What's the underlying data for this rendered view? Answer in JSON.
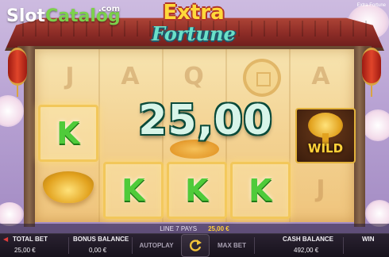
{
  "watermark": {
    "brand_slot": "Slot",
    "brand_catalog": "Catalog",
    "brand_tld": ".com"
  },
  "game_name": "Extra Fortune",
  "logo": {
    "line1": "Extra",
    "line2": "Fortune"
  },
  "reels": {
    "background_symbols": [
      "J",
      "A",
      "Q",
      "A",
      "A",
      "J"
    ],
    "k_symbol": "K",
    "wild_label": "WILD"
  },
  "win": {
    "amount_display": "25,00"
  },
  "status": {
    "pays_text": "LINE 7 PAYS",
    "pays_amount": "25,00 €"
  },
  "bottom_bar": {
    "total_bet_label": "TOTAL BET",
    "total_bet_value": "25,00 €",
    "bonus_balance_label": "BONUS BALANCE",
    "bonus_balance_value": "0,00 €",
    "autoplay_label": "AUTOPLAY",
    "max_bet_label": "MAX BET",
    "cash_balance_label": "CASH BALANCE",
    "cash_balance_value": "492,00 €",
    "win_label": "WIN"
  },
  "icons": {
    "spin": "spin-arrows-icon",
    "bet_left": "arrow-left-icon"
  },
  "colors": {
    "win_digits": "#d8f5e9",
    "k_symbol": "#4fcb3a",
    "pays_amount": "#ffcf3a",
    "wild": "#ffd23a"
  }
}
